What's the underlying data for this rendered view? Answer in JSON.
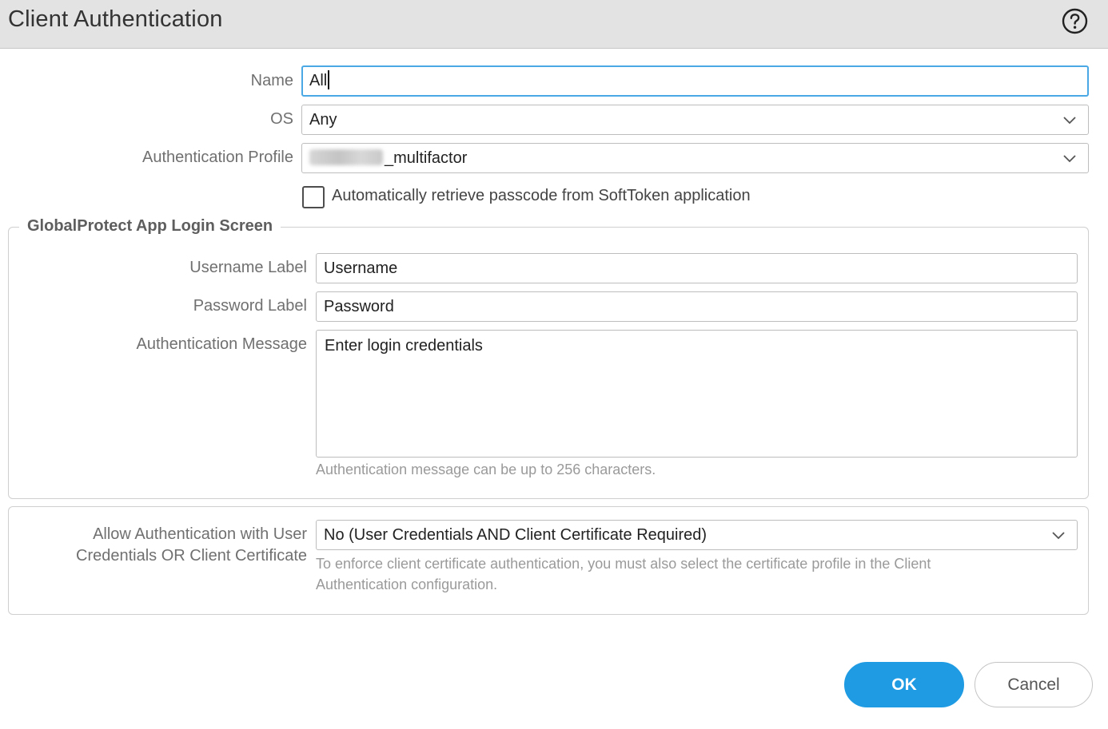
{
  "dialog": {
    "title": "Client Authentication",
    "help_icon": "help-circle-icon"
  },
  "form": {
    "name": {
      "label": "Name",
      "value": "All"
    },
    "os": {
      "label": "OS",
      "value": "Any"
    },
    "auth_profile": {
      "label": "Authentication Profile",
      "value_suffix": "_multifactor",
      "value_prefix_redacted": true
    },
    "softtoken_checkbox": {
      "label": "Automatically retrieve passcode from SoftToken application",
      "checked": false
    }
  },
  "login_screen": {
    "legend": "GlobalProtect App Login Screen",
    "username_label": {
      "label": "Username Label",
      "value": "Username"
    },
    "password_label": {
      "label": "Password Label",
      "value": "Password"
    },
    "auth_message": {
      "label": "Authentication Message",
      "value": "Enter login credentials",
      "hint": "Authentication message can be up to 256 characters."
    }
  },
  "allow_auth": {
    "label_line1": "Allow Authentication with User",
    "label_line2": "Credentials OR Client Certificate",
    "value": "No (User Credentials AND Client Certificate Required)",
    "hint_line1": "To enforce client certificate authentication, you must also select the certificate profile in the Client",
    "hint_line2": "Authentication configuration."
  },
  "buttons": {
    "ok": "OK",
    "cancel": "Cancel"
  },
  "colors": {
    "accent": "#1e9be3",
    "focus_border": "#4aa9e4",
    "titlebar": "#e3e3e3"
  }
}
